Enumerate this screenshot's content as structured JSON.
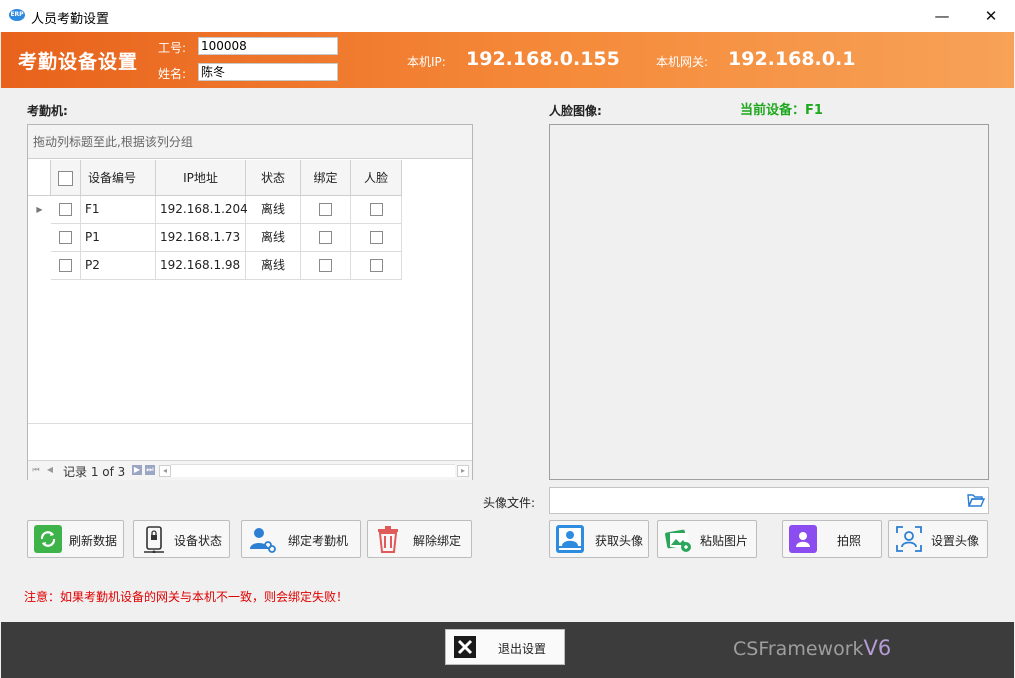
{
  "window": {
    "icon_text": "ERP",
    "title": "人员考勤设置",
    "minimize_glyph": "—",
    "close_glyph": "✕"
  },
  "header": {
    "title": "考勤设备设置",
    "emp_id_label": "工号:",
    "emp_id_value": "100008",
    "name_label": "姓名:",
    "name_value": "陈冬",
    "local_ip_label": "本机IP:",
    "local_ip_value": "192.168.0.155",
    "gateway_label": "本机网关:",
    "gateway_value": "192.168.0.1"
  },
  "device_section": {
    "label": "考勤机:",
    "group_hint": "拖动列标题至此,根据该列分组",
    "columns": [
      "设备编号",
      "IP地址",
      "状态",
      "绑定",
      "人脸"
    ],
    "rows": [
      {
        "code": "F1",
        "ip": "192.168.1.204",
        "status": "离线",
        "bound": false,
        "face": false,
        "selected": true
      },
      {
        "code": "P1",
        "ip": "192.168.1.73",
        "status": "离线",
        "bound": false,
        "face": false,
        "selected": false
      },
      {
        "code": "P2",
        "ip": "192.168.1.98",
        "status": "离线",
        "bound": false,
        "face": false,
        "selected": false
      }
    ],
    "record_info": "记录 1 of 3"
  },
  "face_section": {
    "label": "人脸图像:",
    "current_device": "当前设备：F1",
    "file_label": "头像文件:",
    "file_value": ""
  },
  "buttons": {
    "refresh": "刷新数据",
    "device_status": "设备状态",
    "bind_device": "绑定考勤机",
    "unbind": "解除绑定",
    "get_avatar": "获取头像",
    "paste_image": "粘贴图片",
    "take_photo": "拍照",
    "set_avatar": "设置头像",
    "exit": "退出设置"
  },
  "note": "注意：如果考勤机设备的网关与本机不一致，则会绑定失败！",
  "brand": {
    "name": "CSFramework",
    "version": "V6"
  },
  "colors": {
    "header_start": "#e8621c",
    "header_end": "#f7a257",
    "current_device": "#1fa81f",
    "note": "#e00000",
    "footer": "#3c3c3c"
  }
}
